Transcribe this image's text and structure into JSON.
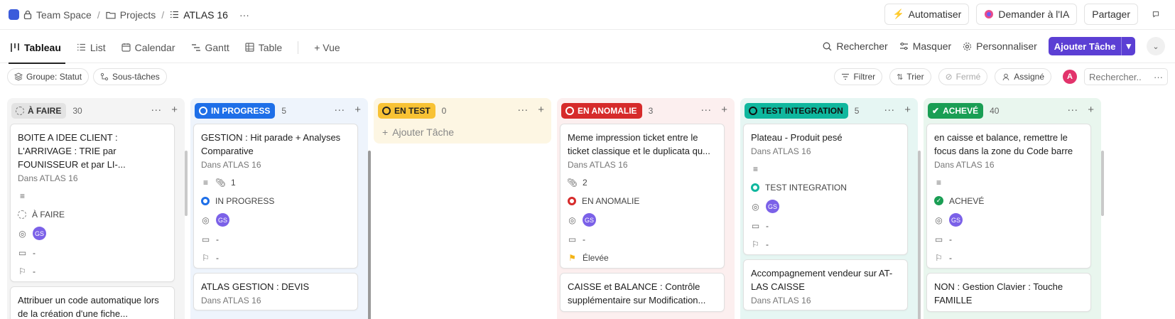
{
  "breadcrumb": {
    "space": "Team Space",
    "folder": "Projects",
    "list": "ATLAS 16"
  },
  "top_actions": {
    "automate": "Automatiser",
    "ai": "Demander à l'IA",
    "share": "Partager"
  },
  "views": [
    "Tableau",
    "List",
    "Calendar",
    "Gantt",
    "Table"
  ],
  "add_view": "+ Vue",
  "view_tools": {
    "search": "Rechercher",
    "hide": "Masquer",
    "customize": "Personnaliser",
    "add_task": "Ajouter Tâche"
  },
  "filters": {
    "group": "Groupe: Statut",
    "subtasks": "Sous-tâches",
    "filter": "Filtrer",
    "sort": "Trier",
    "closed": "Fermé",
    "assigned": "Assigné",
    "avatar": "A",
    "search_placeholder": "Rechercher.."
  },
  "card_location": "Dans ATLAS 16",
  "columns": [
    {
      "label": "À FAIRE",
      "count": "30",
      "cards": [
        {
          "title": "BOITE A IDEE CLIENT : L'ARRIVAGE : TRIE par FOUNISSEUR et par LI-...",
          "status": "À FAIRE",
          "assignee": "GS",
          "date": "-",
          "priority": "-"
        },
        {
          "title": "Attribuer un code automatique lors de la création d'une fiche..."
        }
      ]
    },
    {
      "label": "IN PROGRESS",
      "count": "5",
      "cards": [
        {
          "title": "GESTION : Hit parade + Analyses Comparative",
          "attachments": "1",
          "status": "IN PROGRESS",
          "assignee": "GS",
          "date": "-",
          "priority": "-"
        },
        {
          "title": "ATLAS GESTION : DEVIS"
        }
      ]
    },
    {
      "label": "EN TEST",
      "count": "0",
      "add_label": "Ajouter Tâche",
      "cards": []
    },
    {
      "label": "EN ANOMALIE",
      "count": "3",
      "cards": [
        {
          "title": "Meme impression ticket entre le ticket classique et le duplicata qu...",
          "attachments": "2",
          "status": "EN ANOMALIE",
          "assignee": "GS",
          "date": "-",
          "priority": "Élevée"
        },
        {
          "title": "CAISSE et BALANCE : Contrôle supplémentaire sur Modification..."
        }
      ]
    },
    {
      "label": "TEST INTEGRATION",
      "count": "5",
      "cards": [
        {
          "title": "Plateau - Produit pesé",
          "status": "TEST INTEGRATION",
          "assignee": "GS",
          "date": "-",
          "priority": "-"
        },
        {
          "title": "Accompagnement vendeur sur AT-LAS CAISSE"
        }
      ]
    },
    {
      "label": "ACHEVÉ",
      "count": "40",
      "cards": [
        {
          "title": "en caisse et balance, remettre le focus dans la zone du Code barre",
          "status": "ACHEVÉ",
          "assignee": "GS",
          "date": "-",
          "priority": "-"
        },
        {
          "title": "NON : Gestion Clavier : Touche FAMILLE"
        }
      ]
    }
  ],
  "colors": {
    "accent": "#5b3fd4",
    "todo": "#efefef",
    "in_progress": "#1e6fe8",
    "en_test": "#f8c234",
    "en_anomalie": "#d62b2b",
    "test_integration": "#0fb79e",
    "acheve": "#1a9e54",
    "priority_high": "#f3b316"
  }
}
